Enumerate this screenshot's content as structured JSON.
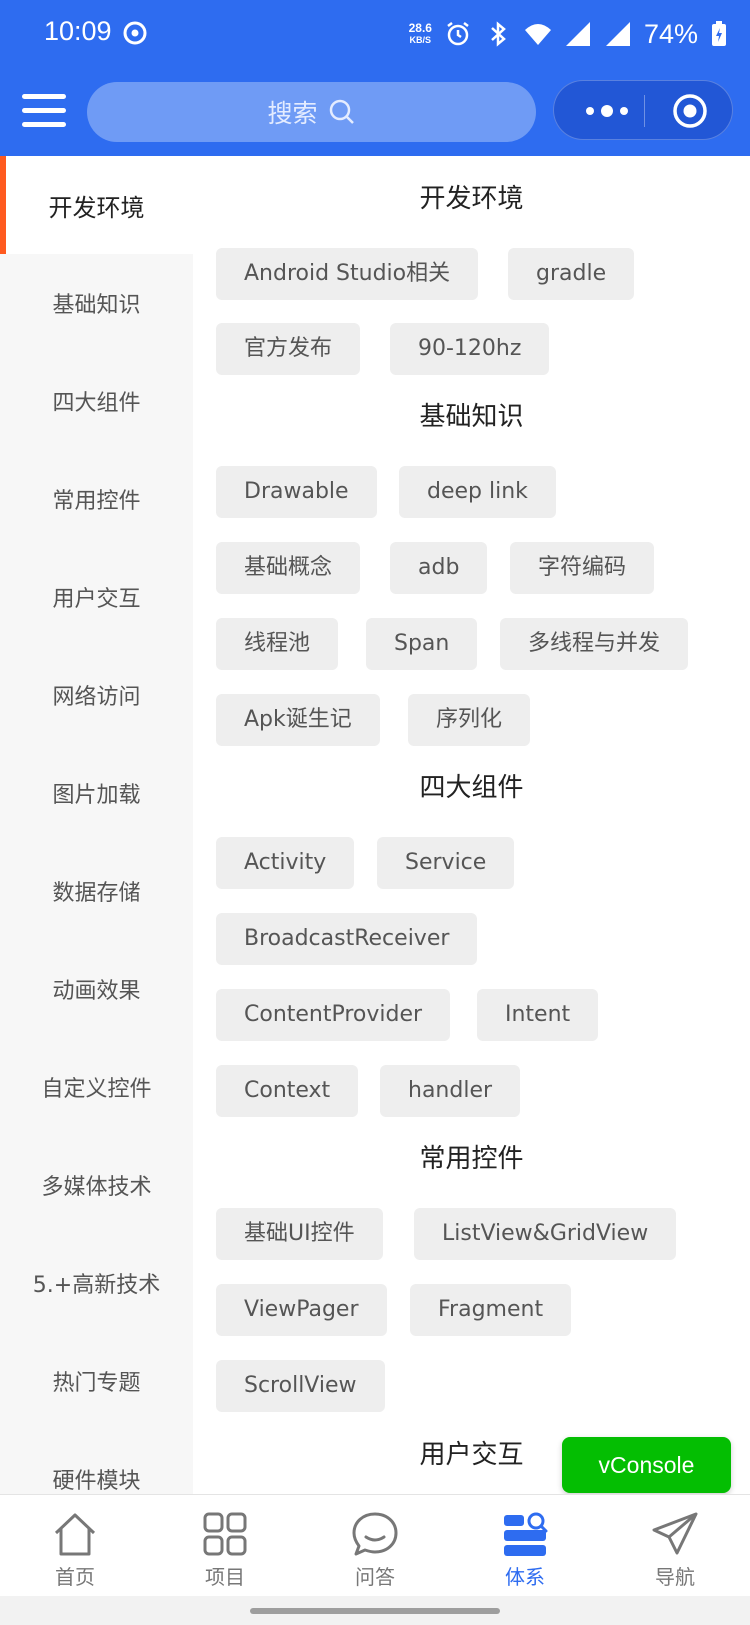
{
  "status_bar": {
    "time": "10:09",
    "net_speed_value": "28.6",
    "net_speed_unit": "KB/S",
    "battery": "74%"
  },
  "search": {
    "label": "搜索"
  },
  "sidebar": {
    "items": [
      {
        "label": "开发环境",
        "active": true
      },
      {
        "label": "基础知识"
      },
      {
        "label": "四大组件"
      },
      {
        "label": "常用控件"
      },
      {
        "label": "用户交互"
      },
      {
        "label": "网络访问"
      },
      {
        "label": "图片加载"
      },
      {
        "label": "数据存储"
      },
      {
        "label": "动画效果"
      },
      {
        "label": "自定义控件"
      },
      {
        "label": "多媒体技术"
      },
      {
        "label": "5.+高新技术"
      },
      {
        "label": "热门专题"
      },
      {
        "label": "硬件模块"
      }
    ]
  },
  "sections": [
    {
      "title": "开发环境",
      "tags": [
        "Android Studio相关",
        "gradle",
        "官方发布",
        "90-120hz"
      ]
    },
    {
      "title": "基础知识",
      "tags": [
        "Drawable",
        "deep link",
        "基础概念",
        "adb",
        "字符编码",
        "线程池",
        "Span",
        "多线程与并发",
        "Apk诞生记",
        "序列化"
      ]
    },
    {
      "title": "四大组件",
      "tags": [
        "Activity",
        "Service",
        "BroadcastReceiver",
        "ContentProvider",
        "Intent",
        "Context",
        "handler"
      ]
    },
    {
      "title": "常用控件",
      "tags": [
        "基础UI控件",
        "ListView&GridView",
        "ViewPager",
        "Fragment",
        "ScrollView"
      ]
    },
    {
      "title": "用户交互",
      "tags": []
    }
  ],
  "vconsole": {
    "label": "vConsole"
  },
  "tabbar": {
    "tabs": [
      {
        "label": "首页",
        "icon": "home-icon"
      },
      {
        "label": "项目",
        "icon": "grid-icon"
      },
      {
        "label": "问答",
        "icon": "chat-bubble-icon"
      },
      {
        "label": "体系",
        "icon": "system-icon",
        "active": true
      },
      {
        "label": "导航",
        "icon": "paper-plane-icon"
      }
    ]
  },
  "colors": {
    "primary": "#2e6cf0",
    "accent_bar": "#ff5a1f",
    "vconsole": "#04be02",
    "tag_bg": "#eeeeee"
  }
}
